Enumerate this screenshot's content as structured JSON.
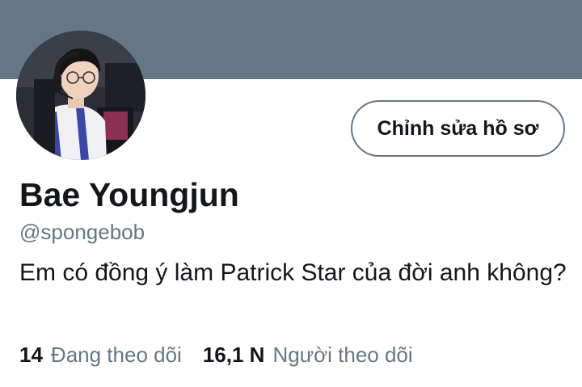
{
  "profile": {
    "name": "Bae Youngjun",
    "handle": "@spongebob",
    "bio": "Em có đồng ý làm Patrick Star của đời anh không?",
    "edit_button": "Chỉnh sửa hồ sơ",
    "following_count": "14",
    "following_label": "Đang theo dõi",
    "followers_count": "16,1 N",
    "followers_label": "Người theo dõi"
  },
  "colors": {
    "banner": "#657786",
    "secondary_text": "#657786",
    "primary_text": "#14171a",
    "background": "#ffffff"
  }
}
